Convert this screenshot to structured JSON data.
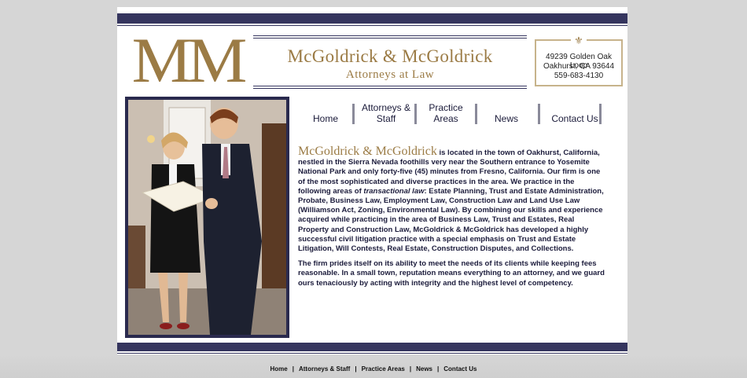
{
  "header": {
    "logo_text": "MM",
    "firm_name": "McGoldrick & McGoldrick",
    "tagline": "Attorneys at Law"
  },
  "address": {
    "ornament": "⚜",
    "street": "49239 Golden Oak Loop",
    "city": "Oakhurst, CA 93644",
    "phone": "559-683-4130"
  },
  "nav": {
    "home": "Home",
    "attorneys": "Attorneys & Staff",
    "practice": "Practice Areas",
    "news": "News",
    "contact": "Contact Us"
  },
  "content": {
    "lead_name": "McGoldrick & McGoldrick",
    "para1": " is located in the town of Oakhurst, California, nestled in the Sierra Nevada foothills very near the Southern entrance to Yosemite National Park and only forty-five (45) minutes from Fresno, California. Our firm is one of the most sophisticated and diverse practices in the area.   We practice in the following areas of ",
    "para1_italic": "transactional law",
    "para1_rest": ": Estate Planning, Trust and Estate Administration, Probate, Business Law, Employment Law, Construction Law and Land Use Law (Williamson Act, Zoning, Environmental Law).  By combining our skills and experience acquired while practicing in the area of Business Law, Trust and Estates, Real Property and Construction Law, McGoldrick & McGoldrick has developed a highly successful civil litigation practice with a special emphasis on Trust and Estate Litigation, Will Contests, Real Estate, Construction Disputes, and Collections.",
    "para2": "The firm prides itself on its ability to meet the needs of its clients while keeping fees reasonable.  In a small town, reputation means everything to an attorney, and we guard ours tenaciously by acting with integrity and the highest level of competency."
  },
  "footer": {
    "home": "Home",
    "attorneys": "Attorneys & Staff",
    "practice": "Practice Areas",
    "news": "News",
    "contact": "Contact Us",
    "separator": "|"
  },
  "colors": {
    "navy": "#35355e",
    "gold": "#9b7b45",
    "background": "#d6d6d6"
  }
}
